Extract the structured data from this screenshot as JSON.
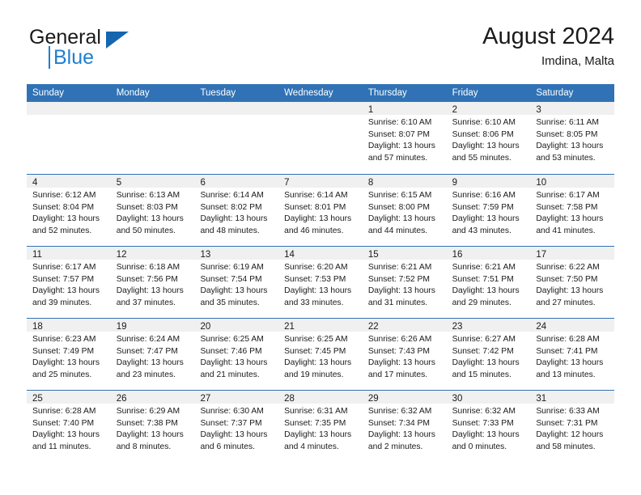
{
  "logo": {
    "word_one": "General",
    "word_two": "Blue",
    "triangle_icon": "blue-triangle-icon"
  },
  "header": {
    "title": "August 2024",
    "subtitle": "Imdina, Malta"
  },
  "colors": {
    "header_blue": "#3072b5",
    "logo_blue": "#1f7fd0",
    "day_band_gray": "#f0f0f0",
    "text": "#1a1a1a"
  },
  "weekdays": [
    "Sunday",
    "Monday",
    "Tuesday",
    "Wednesday",
    "Thursday",
    "Friday",
    "Saturday"
  ],
  "weeks": [
    [
      {
        "day": "",
        "empty": true
      },
      {
        "day": "",
        "empty": true
      },
      {
        "day": "",
        "empty": true
      },
      {
        "day": "",
        "empty": true
      },
      {
        "day": "1",
        "sunrise": "Sunrise: 6:10 AM",
        "sunset": "Sunset: 8:07 PM",
        "daylight_1": "Daylight: 13 hours",
        "daylight_2": "and 57 minutes."
      },
      {
        "day": "2",
        "sunrise": "Sunrise: 6:10 AM",
        "sunset": "Sunset: 8:06 PM",
        "daylight_1": "Daylight: 13 hours",
        "daylight_2": "and 55 minutes."
      },
      {
        "day": "3",
        "sunrise": "Sunrise: 6:11 AM",
        "sunset": "Sunset: 8:05 PM",
        "daylight_1": "Daylight: 13 hours",
        "daylight_2": "and 53 minutes."
      }
    ],
    [
      {
        "day": "4",
        "sunrise": "Sunrise: 6:12 AM",
        "sunset": "Sunset: 8:04 PM",
        "daylight_1": "Daylight: 13 hours",
        "daylight_2": "and 52 minutes."
      },
      {
        "day": "5",
        "sunrise": "Sunrise: 6:13 AM",
        "sunset": "Sunset: 8:03 PM",
        "daylight_1": "Daylight: 13 hours",
        "daylight_2": "and 50 minutes."
      },
      {
        "day": "6",
        "sunrise": "Sunrise: 6:14 AM",
        "sunset": "Sunset: 8:02 PM",
        "daylight_1": "Daylight: 13 hours",
        "daylight_2": "and 48 minutes."
      },
      {
        "day": "7",
        "sunrise": "Sunrise: 6:14 AM",
        "sunset": "Sunset: 8:01 PM",
        "daylight_1": "Daylight: 13 hours",
        "daylight_2": "and 46 minutes."
      },
      {
        "day": "8",
        "sunrise": "Sunrise: 6:15 AM",
        "sunset": "Sunset: 8:00 PM",
        "daylight_1": "Daylight: 13 hours",
        "daylight_2": "and 44 minutes."
      },
      {
        "day": "9",
        "sunrise": "Sunrise: 6:16 AM",
        "sunset": "Sunset: 7:59 PM",
        "daylight_1": "Daylight: 13 hours",
        "daylight_2": "and 43 minutes."
      },
      {
        "day": "10",
        "sunrise": "Sunrise: 6:17 AM",
        "sunset": "Sunset: 7:58 PM",
        "daylight_1": "Daylight: 13 hours",
        "daylight_2": "and 41 minutes."
      }
    ],
    [
      {
        "day": "11",
        "sunrise": "Sunrise: 6:17 AM",
        "sunset": "Sunset: 7:57 PM",
        "daylight_1": "Daylight: 13 hours",
        "daylight_2": "and 39 minutes."
      },
      {
        "day": "12",
        "sunrise": "Sunrise: 6:18 AM",
        "sunset": "Sunset: 7:56 PM",
        "daylight_1": "Daylight: 13 hours",
        "daylight_2": "and 37 minutes."
      },
      {
        "day": "13",
        "sunrise": "Sunrise: 6:19 AM",
        "sunset": "Sunset: 7:54 PM",
        "daylight_1": "Daylight: 13 hours",
        "daylight_2": "and 35 minutes."
      },
      {
        "day": "14",
        "sunrise": "Sunrise: 6:20 AM",
        "sunset": "Sunset: 7:53 PM",
        "daylight_1": "Daylight: 13 hours",
        "daylight_2": "and 33 minutes."
      },
      {
        "day": "15",
        "sunrise": "Sunrise: 6:21 AM",
        "sunset": "Sunset: 7:52 PM",
        "daylight_1": "Daylight: 13 hours",
        "daylight_2": "and 31 minutes."
      },
      {
        "day": "16",
        "sunrise": "Sunrise: 6:21 AM",
        "sunset": "Sunset: 7:51 PM",
        "daylight_1": "Daylight: 13 hours",
        "daylight_2": "and 29 minutes."
      },
      {
        "day": "17",
        "sunrise": "Sunrise: 6:22 AM",
        "sunset": "Sunset: 7:50 PM",
        "daylight_1": "Daylight: 13 hours",
        "daylight_2": "and 27 minutes."
      }
    ],
    [
      {
        "day": "18",
        "sunrise": "Sunrise: 6:23 AM",
        "sunset": "Sunset: 7:49 PM",
        "daylight_1": "Daylight: 13 hours",
        "daylight_2": "and 25 minutes."
      },
      {
        "day": "19",
        "sunrise": "Sunrise: 6:24 AM",
        "sunset": "Sunset: 7:47 PM",
        "daylight_1": "Daylight: 13 hours",
        "daylight_2": "and 23 minutes."
      },
      {
        "day": "20",
        "sunrise": "Sunrise: 6:25 AM",
        "sunset": "Sunset: 7:46 PM",
        "daylight_1": "Daylight: 13 hours",
        "daylight_2": "and 21 minutes."
      },
      {
        "day": "21",
        "sunrise": "Sunrise: 6:25 AM",
        "sunset": "Sunset: 7:45 PM",
        "daylight_1": "Daylight: 13 hours",
        "daylight_2": "and 19 minutes."
      },
      {
        "day": "22",
        "sunrise": "Sunrise: 6:26 AM",
        "sunset": "Sunset: 7:43 PM",
        "daylight_1": "Daylight: 13 hours",
        "daylight_2": "and 17 minutes."
      },
      {
        "day": "23",
        "sunrise": "Sunrise: 6:27 AM",
        "sunset": "Sunset: 7:42 PM",
        "daylight_1": "Daylight: 13 hours",
        "daylight_2": "and 15 minutes."
      },
      {
        "day": "24",
        "sunrise": "Sunrise: 6:28 AM",
        "sunset": "Sunset: 7:41 PM",
        "daylight_1": "Daylight: 13 hours",
        "daylight_2": "and 13 minutes."
      }
    ],
    [
      {
        "day": "25",
        "sunrise": "Sunrise: 6:28 AM",
        "sunset": "Sunset: 7:40 PM",
        "daylight_1": "Daylight: 13 hours",
        "daylight_2": "and 11 minutes."
      },
      {
        "day": "26",
        "sunrise": "Sunrise: 6:29 AM",
        "sunset": "Sunset: 7:38 PM",
        "daylight_1": "Daylight: 13 hours",
        "daylight_2": "and 8 minutes."
      },
      {
        "day": "27",
        "sunrise": "Sunrise: 6:30 AM",
        "sunset": "Sunset: 7:37 PM",
        "daylight_1": "Daylight: 13 hours",
        "daylight_2": "and 6 minutes."
      },
      {
        "day": "28",
        "sunrise": "Sunrise: 6:31 AM",
        "sunset": "Sunset: 7:35 PM",
        "daylight_1": "Daylight: 13 hours",
        "daylight_2": "and 4 minutes."
      },
      {
        "day": "29",
        "sunrise": "Sunrise: 6:32 AM",
        "sunset": "Sunset: 7:34 PM",
        "daylight_1": "Daylight: 13 hours",
        "daylight_2": "and 2 minutes."
      },
      {
        "day": "30",
        "sunrise": "Sunrise: 6:32 AM",
        "sunset": "Sunset: 7:33 PM",
        "daylight_1": "Daylight: 13 hours",
        "daylight_2": "and 0 minutes."
      },
      {
        "day": "31",
        "sunrise": "Sunrise: 6:33 AM",
        "sunset": "Sunset: 7:31 PM",
        "daylight_1": "Daylight: 12 hours",
        "daylight_2": "and 58 minutes."
      }
    ]
  ]
}
